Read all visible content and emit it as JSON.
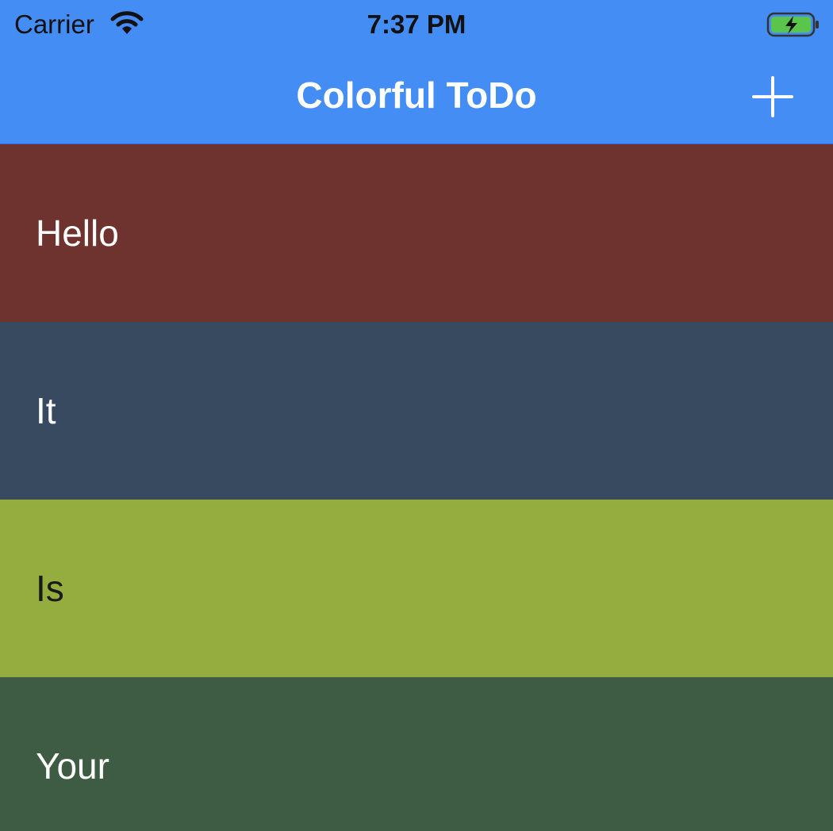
{
  "status_bar": {
    "carrier": "Carrier",
    "time": "7:37 PM",
    "wifi_icon": "wifi-icon",
    "battery_icon": "battery-charging-icon"
  },
  "nav": {
    "title": "Colorful ToDo",
    "add_icon": "plus-icon",
    "background": "#448DF5"
  },
  "items": [
    {
      "label": "Hello",
      "color": "#6F332F",
      "text_color": "#FFFFFF"
    },
    {
      "label": "It",
      "color": "#374A60",
      "text_color": "#FFFFFF"
    },
    {
      "label": "Is",
      "color": "#95AD3F",
      "text_color": "#1A1A1A"
    },
    {
      "label": "Your",
      "color": "#3E5C43",
      "text_color": "#FFFFFF"
    }
  ]
}
